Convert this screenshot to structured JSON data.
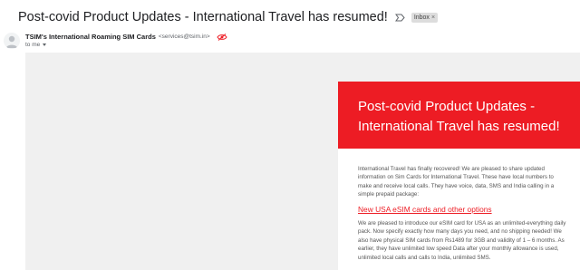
{
  "email": {
    "subject": "Post-covid Product Updates - International Travel has resumed!",
    "label_chip": "Inbox",
    "label_chip_close": "×",
    "sender_name": "TSIM's International Roaming SIM Cards",
    "sender_email": "<services@tsim.in>",
    "recipient_line": "to me"
  },
  "newsletter": {
    "headline": "Post-covid Product Updates - International Travel has resumed!",
    "intro": "International Travel has finally recovered! We are pleased to share updated information on Sim Cards for International Travel. These have local numbers to make and receive local calls. They have voice, data, SMS and India calling in a simple prepaid package:",
    "esim_link": "New USA eSIM cards and other options",
    "esim_paragraph": "We are pleased to introduce our eSIM card for USA as an unlimited-everything daily pack. Now specify exactly how many days you need, and no shipping needed! We also have physical SIM cards from Rs1489 for 3GB and validity of 1 – 6 months. As earlier, they have unlimited low speed Data after your monthly allowance is used, unlimited local calls and calls to India, unlimited SMS."
  },
  "colors": {
    "brand_red": "#ed1c24",
    "email_background": "#f0f0f0",
    "chip_background": "#dddddd"
  },
  "icons": {
    "important": "important-marker-icon",
    "spam_warning": "eye-slash-icon",
    "avatar": "person-avatar-icon",
    "recipient_details": "caret-down-icon"
  }
}
